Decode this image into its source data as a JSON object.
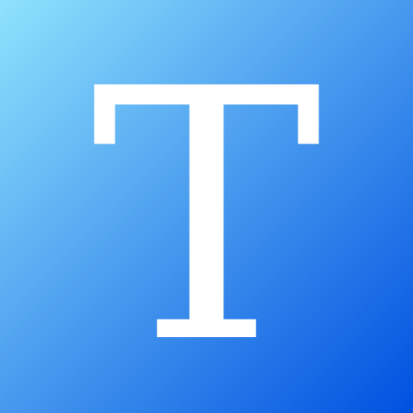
{
  "icon": {
    "letter": "T",
    "letter_color": "#ffffff",
    "gradient_start": "#8ee2fc",
    "gradient_end": "#0050e0"
  }
}
